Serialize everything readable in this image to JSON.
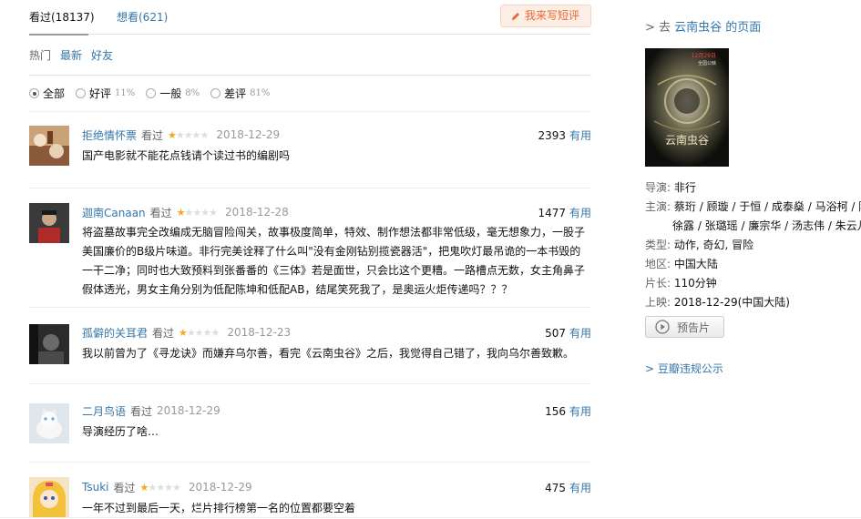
{
  "tabs": {
    "watched": "看过(18137)",
    "want": "想看(621)",
    "write_review": "我来写短评"
  },
  "sort": {
    "hot": "热门",
    "latest": "最新",
    "friends": "好友"
  },
  "filters": [
    {
      "label": "全部",
      "pct": "",
      "checked": true
    },
    {
      "label": "好评",
      "pct": "11%",
      "checked": false
    },
    {
      "label": "一般",
      "pct": "8%",
      "checked": false
    },
    {
      "label": "差评",
      "pct": "81%",
      "checked": false
    }
  ],
  "comments": [
    {
      "user": "拒绝情怀票",
      "status": "看过",
      "stars": 1,
      "date": "2018-12-29",
      "votes": "2393",
      "useful": "有用",
      "text": "国产电影就不能花点钱请个读过书的编剧吗"
    },
    {
      "user": "迦南Canaan",
      "status": "看过",
      "stars": 1,
      "date": "2018-12-28",
      "votes": "1477",
      "useful": "有用",
      "text": "将盗墓故事完全改编成无脑冒险闯关，故事极度简单，特效、制作想法都非常低级，毫无想象力，一股子美国廉价的B级片味道。非行完美诠释了什么叫\"没有金刚钻别揽瓷器活\"，把鬼吹灯最吊诡的一本书毁的一干二净；同时也大致预料到张番番的《三体》若是面世，只会比这个更糟。一路槽点无数，女主角鼻子假体透光，男女主角分别为低配陈坤和低配AB，结尾笑死我了，是奥运火炬传递吗？？？"
    },
    {
      "user": "孤僻的关耳君",
      "status": "看过",
      "stars": 1,
      "date": "2018-12-23",
      "votes": "507",
      "useful": "有用",
      "text": "我以前曾为了《寻龙诀》而嫌弃乌尔善，看完《云南虫谷》之后，我觉得自己错了，我向乌尔善致歉。"
    },
    {
      "user": "二月鸟语",
      "status": "看过",
      "stars": 0,
      "date": "2018-12-29",
      "votes": "156",
      "useful": "有用",
      "text": "导演经历了啥…"
    },
    {
      "user": "Tsuki",
      "status": "看过",
      "stars": 1,
      "date": "2018-12-29",
      "votes": "475",
      "useful": "有用",
      "text": "一年不过到最后一天，烂片排行榜第一名的位置都要空着"
    }
  ],
  "sidebar": {
    "go_page": "云南虫谷 的页面",
    "go_prefix": "> 去",
    "director_label": "导演:",
    "director": "非行",
    "cast_label": "主演:",
    "cast_line1": "蔡珩 / 顾璇 / 于恒 / 成泰燊 / 马浴柯 / 陈萌",
    "cast_line2": "徐露 / 张璐瑶 / 廉宗华 / 汤志伟 / 朱云儿",
    "genre_label": "类型:",
    "genre": "动作, 奇幻, 冒险",
    "region_label": "地区:",
    "region": "中国大陆",
    "length_label": "片长:",
    "length": "110分钟",
    "release_label": "上映:",
    "release": "2018-12-29(中国大陆)",
    "trailer": "预告片",
    "report": "> 豆瓣违规公示",
    "poster_date": "12月29日",
    "poster_date2": "全国公映",
    "poster_title": "云南虫谷"
  }
}
